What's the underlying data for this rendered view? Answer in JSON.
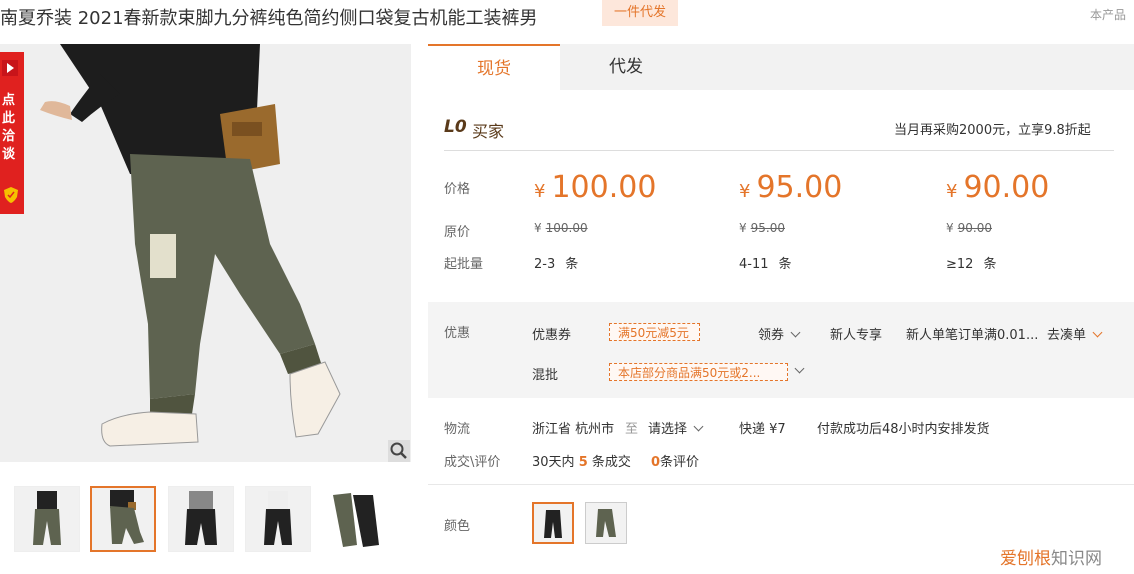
{
  "title": "南夏乔装 2021春新款束脚九分裤纯色简约侧口袋复古机能工装裤男",
  "badge": "一件代发",
  "corner_text": "本产品",
  "side_strip": {
    "text": "点此洽谈"
  },
  "tabs": [
    {
      "label": "现货",
      "active": true
    },
    {
      "label": "代发",
      "active": false
    }
  ],
  "buyer": {
    "logo": "L0",
    "label": "买家",
    "promo": "当月再采购2000元，立享9.8折起"
  },
  "pricing": {
    "labels": {
      "price": "价格",
      "original": "原价",
      "moq": "起批量"
    },
    "currency": "¥",
    "tiers": [
      {
        "price": "100.00",
        "original": "100.00",
        "qty": "2-3",
        "unit": "条"
      },
      {
        "price": "95.00",
        "original": "95.00",
        "qty": "4-11",
        "unit": "条"
      },
      {
        "price": "90.00",
        "original": "90.00",
        "qty": "≥12",
        "unit": "条"
      }
    ]
  },
  "discount": {
    "label": "优惠",
    "coupon_label": "优惠券",
    "coupon_value": "满50元减5元",
    "get_coupon": "领券",
    "new_user_label": "新人专享",
    "new_user_text": "新人单笔订单满0.01...",
    "go_order": "去凑单",
    "mix_label": "混批",
    "mix_value": "本店部分商品满50元或2..."
  },
  "logistics": {
    "label": "物流",
    "origin": "浙江省 杭州市",
    "to": "至",
    "dest_placeholder": "请选择",
    "shipping": "快递 ¥7",
    "dispatch": "付款成功后48小时内安排发货"
  },
  "deals": {
    "label": "成交\\评价",
    "prefix": "30天内",
    "count": "5",
    "suffix": "条成交",
    "reviews": "0",
    "reviews_suffix": "条评价"
  },
  "color": {
    "label": "颜色"
  },
  "watermark": {
    "a": "爱刨根",
    "b": "知识网"
  },
  "colors": {
    "accent": "#e4752a",
    "side_strip": "#e0211f"
  },
  "icons": {
    "zoom": "magnifier-icon",
    "chevron": "chevron-down-icon",
    "shield": "shield-icon"
  }
}
